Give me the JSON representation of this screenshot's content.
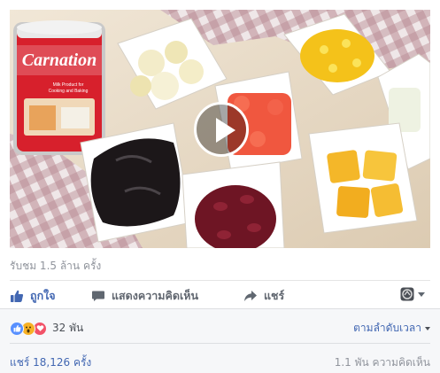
{
  "video": {
    "can_brand": "Carnation",
    "can_subtext": "Milk Product for Cooking and Baking"
  },
  "post": {
    "views_text": "รับชม 1.5 ล้าน ครั้ง",
    "actions": {
      "like_label": "ถูกใจ",
      "comment_label": "แสดงความคิดเห็น",
      "share_label": "แชร์"
    },
    "reactions": {
      "icons": [
        "like-icon",
        "wow-icon",
        "love-icon"
      ],
      "count_text": "32 พัน"
    },
    "sort_label": "ตามลำดับเวลา",
    "shares_text": "แชร์ 18,126 ครั้ง",
    "comments_text": "1.1 พัน ความคิดเห็น"
  },
  "colors": {
    "link_blue": "#4267b2",
    "muted_gray": "#90949c",
    "action_gray": "#616770",
    "like_blue": "#5890ff",
    "wow_yellow": "#f7b125",
    "love_red": "#f25268"
  }
}
